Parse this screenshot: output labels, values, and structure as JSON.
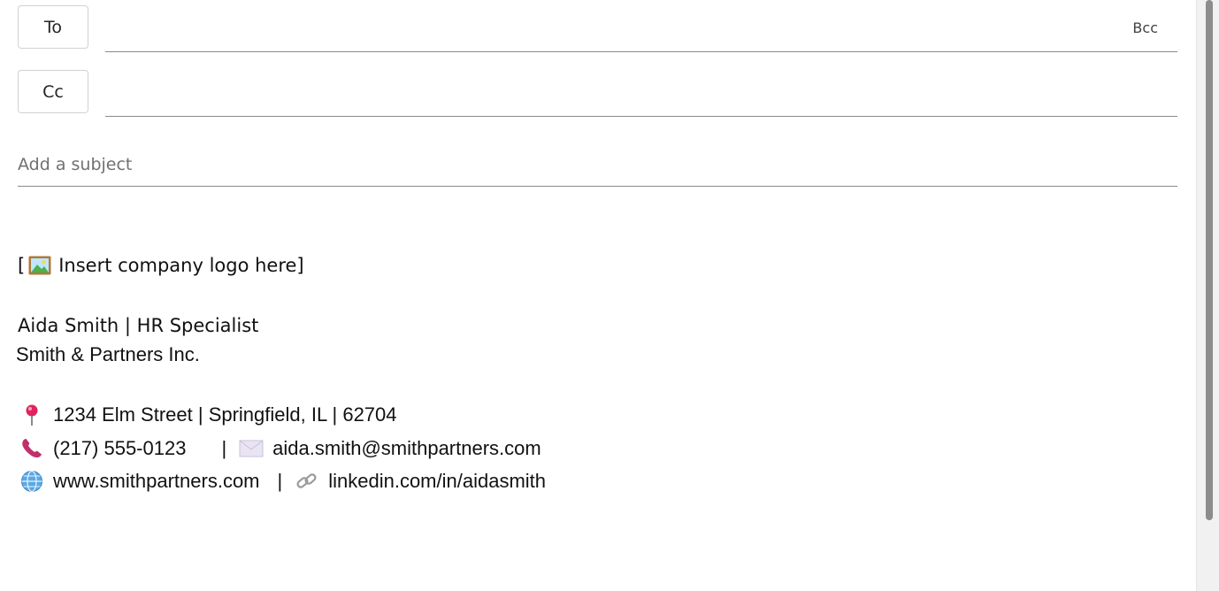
{
  "compose": {
    "to_label": "To",
    "cc_label": "Cc",
    "bcc_label": "Bcc",
    "to_value": "",
    "cc_value": "",
    "subject_placeholder": "Add a subject",
    "subject_value": ""
  },
  "signature": {
    "logo_prefix": "[",
    "logo_text": "Insert company logo here]",
    "logo_icon": "framed-picture-icon",
    "name_title": "Aida Smith | HR Specialist",
    "company": "Smith & Partners Inc.",
    "address_icon": "round-pushpin-icon",
    "address": "1234 Elm Street | Springfield, IL | 62704",
    "phone_icon": "telephone-receiver-icon",
    "phone": "(217) 555-0123",
    "separator": "|",
    "email_icon": "envelope-icon",
    "email": "aida.smith@smithpartners.com",
    "web_icon": "globe-icon",
    "website": "www.smithpartners.com",
    "link_icon": "link-icon",
    "linkedin": "linkedin.com/in/aidasmith"
  }
}
